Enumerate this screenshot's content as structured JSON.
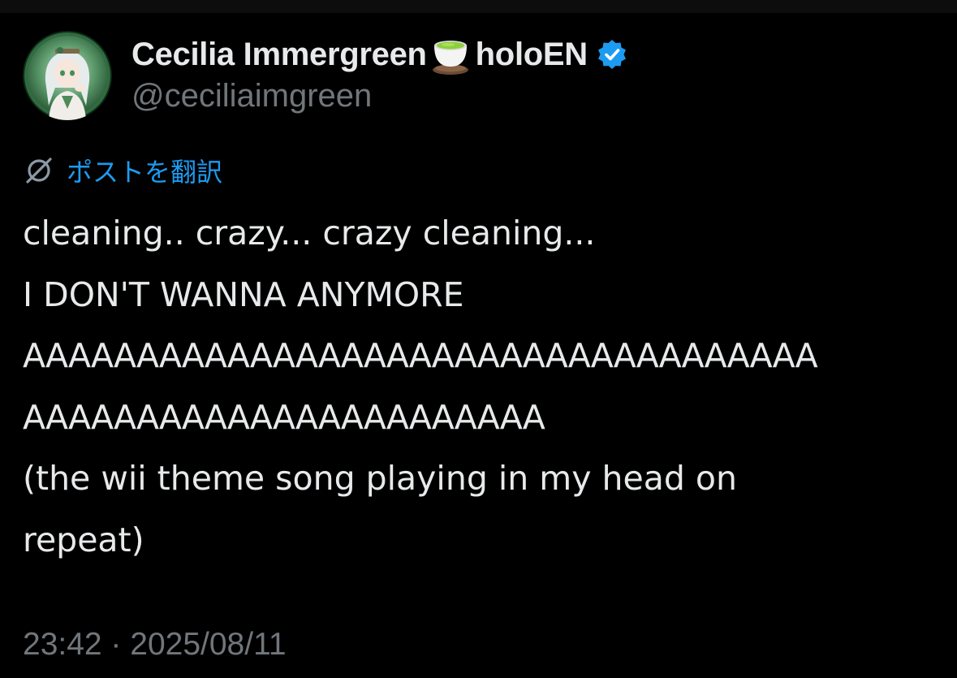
{
  "author": {
    "display_name": "Cecilia Immergreen",
    "name_suffix": "holoEN",
    "handle": "@ceciliaimgreen",
    "name_emoji": "tea-cup-emoji",
    "verified_color": "#1d9bf0"
  },
  "translate": {
    "label": "ポストを翻訳",
    "icon": "translate-globe-icon",
    "color": "#1d9bf0"
  },
  "tweet": {
    "lines": [
      "cleaning.. crazy... crazy cleaning...",
      "I DON'T WANNA ANYMORE",
      "AAAAAAAAAAAAAAAAAAAAAAAAAAAAAAAAAAA",
      "AAAAAAAAAAAAAAAAAAAAAAA",
      "(the wii theme song playing in my head on",
      "repeat)"
    ]
  },
  "meta": {
    "timestamp": "23:42 · 2025/08/11"
  },
  "colors": {
    "background": "#000000",
    "text_primary": "#e7e9ea",
    "text_secondary": "#71767b",
    "accent": "#1d9bf0"
  }
}
